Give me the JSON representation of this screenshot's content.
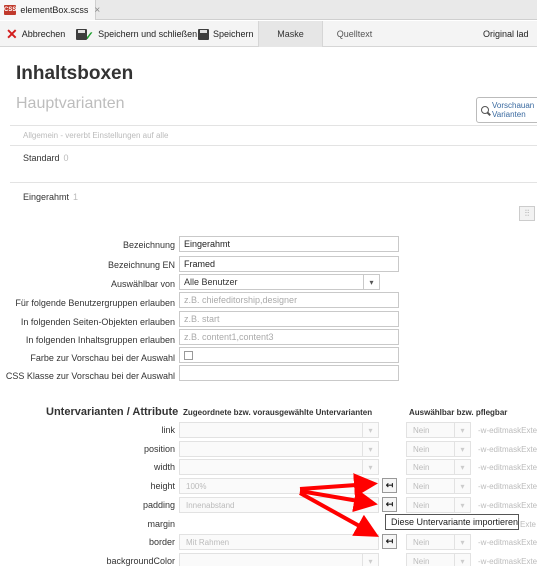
{
  "tab": {
    "filename": "elementBox.scss",
    "icon": "css-file-icon",
    "icon_text": "CSS"
  },
  "toolbar": {
    "cancel": "Abbrechen",
    "save_close": "Speichern und schließen",
    "save": "Speichern",
    "tab_mask": "Maske",
    "tab_source": "Quelltext",
    "original": "Original lad"
  },
  "header": {
    "title": "Inhaltsboxen",
    "subtitle": "Hauptvarianten",
    "preview_line1": "Vorschauan",
    "preview_line2": "Varianten"
  },
  "section": {
    "general": "Allgemein",
    "general_hint": "- vererbt Einstellungen auf alle",
    "standard": {
      "label": "Standard",
      "count": "0"
    },
    "framed": {
      "label": "Eingerahmt",
      "count": "1"
    }
  },
  "form": {
    "name": {
      "label": "Bezeichnung",
      "value": "Eingerahmt"
    },
    "name_en": {
      "label": "Bezeichnung EN",
      "value": "Framed"
    },
    "selectable_by": {
      "label": "Auswählbar von",
      "value": "Alle Benutzer"
    },
    "user_groups": {
      "label": "Für folgende Benutzergruppen erlauben",
      "placeholder": "z.B. chiefeditorship,designer"
    },
    "page_objects": {
      "label": "In folgenden Seiten-Objekten erlauben",
      "placeholder": "z.B. start"
    },
    "content_groups": {
      "label": "In folgenden Inhaltsgruppen erlauben",
      "placeholder": "z.B. content1,content3"
    },
    "preview_color": {
      "label": "Farbe zur Vorschau bei der Auswahl"
    },
    "css_class": {
      "label": "CSS Klasse zur Vorschau bei der Auswahl",
      "value": ""
    }
  },
  "subvariants": {
    "heading": "Untervarianten / Attribute",
    "col_assigned": "Zugeordnete bzw. vorausgewählte Untervarianten",
    "col_selectable": "Auswählbar bzw. pflegbar",
    "rows": [
      {
        "label": "link",
        "value": "",
        "nein": "Nein",
        "ext": "-w-editmaskExte"
      },
      {
        "label": "position",
        "value": "",
        "nein": "Nein",
        "ext": "-w-editmaskExte"
      },
      {
        "label": "width",
        "value": "",
        "nein": "Nein",
        "ext": "-w-editmaskExte"
      },
      {
        "label": "height",
        "value": "100%",
        "nein": "Nein",
        "ext": "-w-editmaskExte"
      },
      {
        "label": "padding",
        "value": "Innenabstand",
        "nein": "Nein",
        "ext": "-w-editmaskExte"
      },
      {
        "label": "margin",
        "value": "",
        "nein": "",
        "ext": "Exte"
      },
      {
        "label": "border",
        "value": "Mit Rahmen",
        "nein": "Nein",
        "ext": "-w-editmaskExte"
      },
      {
        "label": "backgroundColor",
        "value": "",
        "nein": "Nein",
        "ext": "-w-editmaskExte"
      }
    ],
    "import_icon": "import-arrow-icon",
    "tooltip": "Diese Untervariante importieren"
  },
  "colors": {
    "accent_red": "#ff0000",
    "cancel_red": "#d31e1e",
    "check_green": "#1e9e2e"
  }
}
